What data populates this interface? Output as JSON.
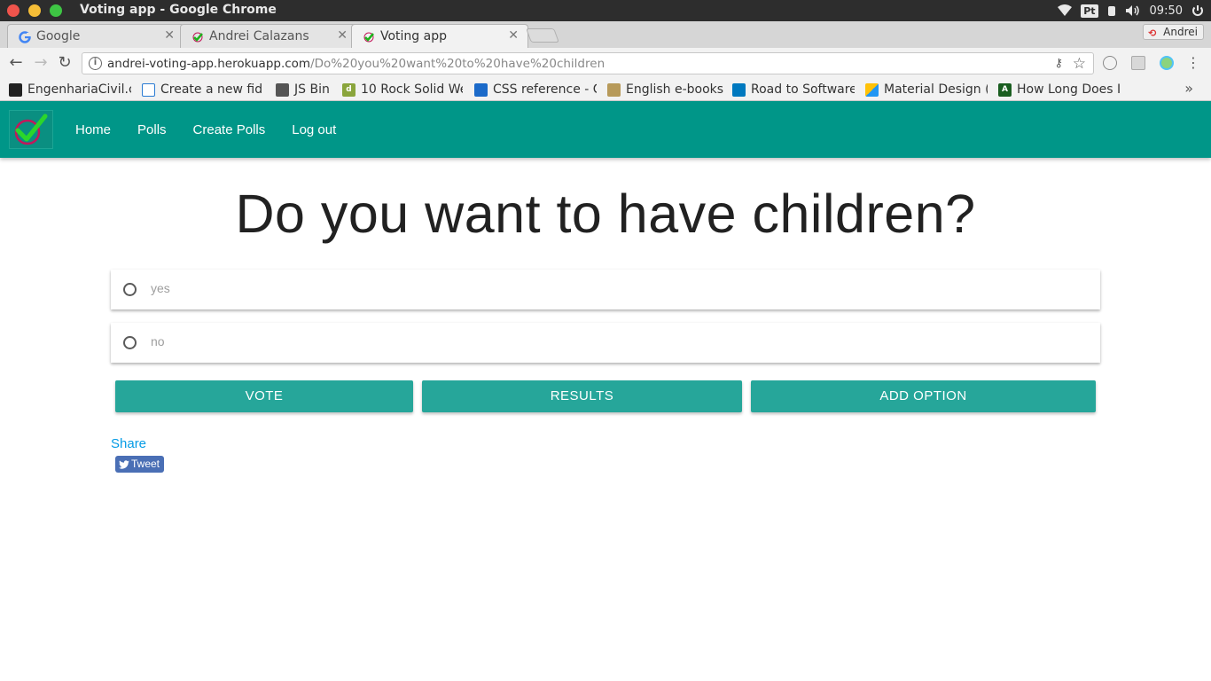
{
  "os": {
    "window_title": "Voting app - Google Chrome",
    "keyboard_layout": "Pt",
    "clock": "09:50"
  },
  "browser": {
    "tabs": [
      {
        "label": "Google",
        "icon": "google-g-icon"
      },
      {
        "label": "Andrei Calazans",
        "icon": "checkmark-favicon-icon"
      },
      {
        "label": "Voting app",
        "icon": "checkmark-favicon-icon",
        "active": true
      }
    ],
    "profile_name": "Andrei",
    "url_host": "andrei-voting-app.herokuapp.com",
    "url_path": "/Do%20you%20want%20to%20have%20children",
    "bookmarks": [
      {
        "label": "EngenhariaCivil.c",
        "icon_color": "#222222"
      },
      {
        "label": "Create a new fid",
        "icon_color": "#2b7cd3"
      },
      {
        "label": "JS Bin",
        "icon_color": "#555555"
      },
      {
        "label": "10 Rock Solid We",
        "icon_color": "#8aa53c"
      },
      {
        "label": "CSS reference - C",
        "icon_color": "#1b6ac9"
      },
      {
        "label": "English e-books",
        "icon_color": "#b79a5a"
      },
      {
        "label": "Road to Software",
        "icon_color": "#0079bf"
      },
      {
        "label": "Material Design (",
        "icon_color": "#2196f3"
      },
      {
        "label": "How Long Does I",
        "icon_color": "#1a5e20"
      }
    ]
  },
  "navbar": {
    "links": [
      "Home",
      "Polls",
      "Create Polls",
      "Log out"
    ],
    "brand_color": "#009688"
  },
  "poll": {
    "question": "Do you want to have children?",
    "options": [
      "yes",
      "no"
    ],
    "buttons": {
      "vote": "VOTE",
      "results": "RESULTS",
      "add_option": "ADD OPTION"
    },
    "button_color": "#26a69a",
    "share_label": "Share",
    "tweet_label": "Tweet"
  }
}
